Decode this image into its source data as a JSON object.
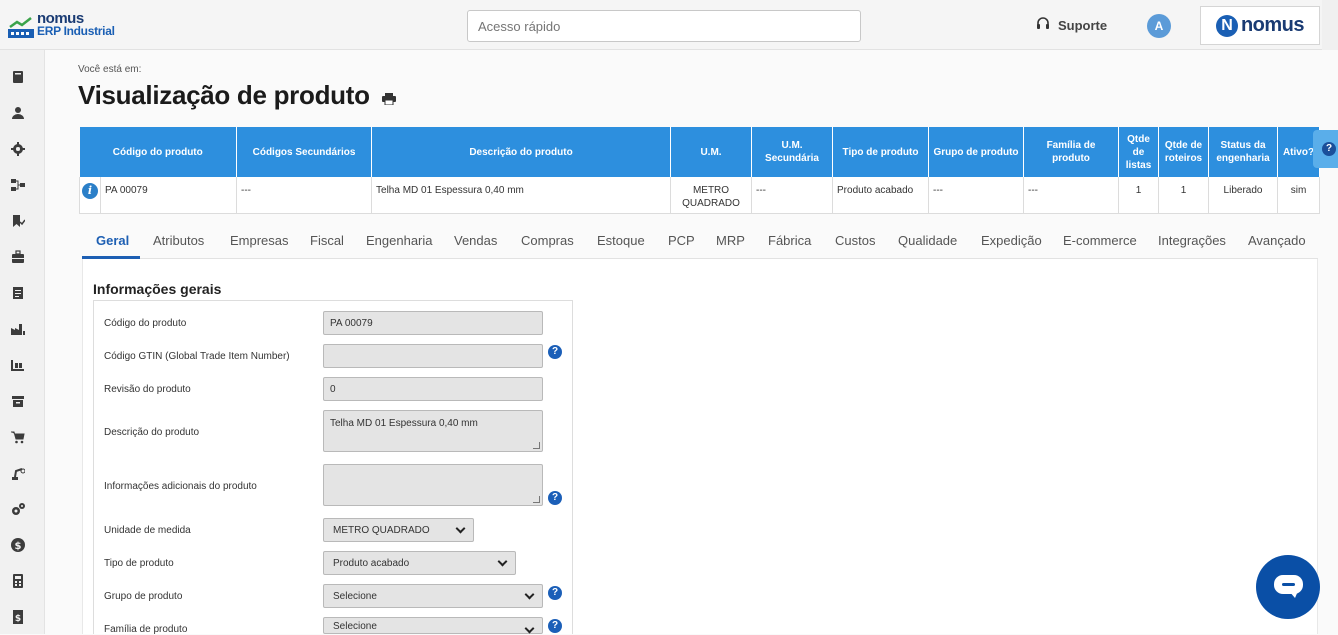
{
  "header": {
    "logo_line1": "nomus",
    "logo_line2": "ERP Industrial",
    "search_placeholder": "Acesso rápido",
    "support_label": "Suporte",
    "avatar_initial": "A",
    "brand_mark": "N",
    "brand_word": "nomus"
  },
  "sidebar": {
    "icons": [
      "book-icon",
      "user-icon",
      "settings-icon",
      "workflow-icon",
      "bookmark-check-icon",
      "briefcase-icon",
      "report-icon",
      "factory-icon",
      "warehouse-icon",
      "archive-icon",
      "cart-icon",
      "robot-arm-icon",
      "gears-icon",
      "dollar-icon",
      "calculator-icon",
      "invoice-icon"
    ]
  },
  "breadcrumb": "Você está em:",
  "page_title": "Visualização de produto",
  "product_table": {
    "headers": [
      "Código do produto",
      "Códigos Secundários",
      "Descrição do produto",
      "U.M.",
      "U.M. Secundária",
      "Tipo de produto",
      "Grupo de produto",
      "Família de produto",
      "Qtde de listas",
      "Qtde de roteiros",
      "Status da engenharia",
      "Ativo?"
    ],
    "row": {
      "info": "i",
      "codigo": "PA 00079",
      "secundarios": "---",
      "descricao": "Telha MD 01 Espessura 0,40 mm",
      "um": "METRO QUADRADO",
      "um_secundaria": "---",
      "tipo": "Produto acabado",
      "grupo": "---",
      "familia": "---",
      "qtde_listas": "1",
      "qtde_roteiros": "1",
      "status": "Liberado",
      "ativo": "sim"
    }
  },
  "help_tab": "?",
  "tabs": [
    "Geral",
    "Atributos",
    "Empresas",
    "Fiscal",
    "Engenharia",
    "Vendas",
    "Compras",
    "Estoque",
    "PCP",
    "MRP",
    "Fábrica",
    "Custos",
    "Qualidade",
    "Expedição",
    "E-commerce",
    "Integrações",
    "Avançado"
  ],
  "form": {
    "section_title": "Informações gerais",
    "codigo_label": "Código do produto",
    "codigo_value": "PA 00079",
    "gtin_label": "Código GTIN (Global Trade Item Number)",
    "gtin_value": "",
    "revisao_label": "Revisão do produto",
    "revisao_value": "0",
    "descricao_label": "Descrição do produto",
    "descricao_value": "Telha MD 01 Espessura 0,40 mm",
    "info_adicionais_label": "Informações adicionais do produto",
    "info_adicionais_value": "",
    "unidade_label": "Unidade de medida",
    "unidade_value": "METRO QUADRADO",
    "tipo_label": "Tipo de produto",
    "tipo_value": "Produto acabado",
    "grupo_label": "Grupo de produto",
    "grupo_value": "Selecione",
    "familia_label": "Família de produto",
    "familia_value": "Selecione",
    "help_mark": "?"
  },
  "colors": {
    "table_header": "#2d8fde",
    "active_tab": "#1d5fb3",
    "chat_button": "#0a4fa6"
  }
}
